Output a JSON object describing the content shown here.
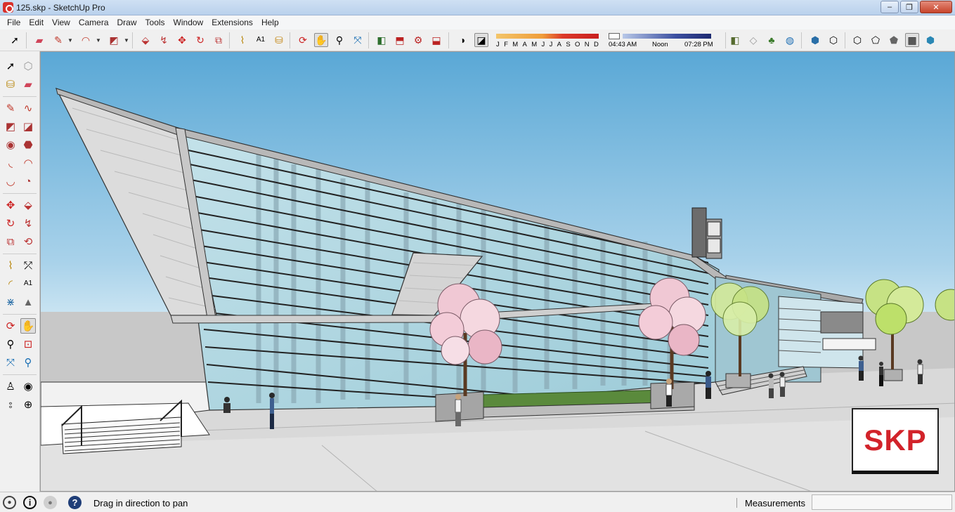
{
  "window": {
    "title": "125.skp - SketchUp Pro",
    "controls": {
      "minimize": "–",
      "maximize": "❐",
      "close": "✕"
    }
  },
  "menu": [
    "File",
    "Edit",
    "View",
    "Camera",
    "Draw",
    "Tools",
    "Window",
    "Extensions",
    "Help"
  ],
  "shadow_settings": {
    "months": [
      "J",
      "F",
      "M",
      "A",
      "M",
      "J",
      "J",
      "A",
      "S",
      "O",
      "N",
      "D"
    ],
    "sunrise": "04:43 AM",
    "noon": "Noon",
    "sunset": "07:28 PM"
  },
  "active_tool": "pan",
  "status": {
    "message": "Drag in direction to pan",
    "measurements_label": "Measurements",
    "measurements_value": ""
  },
  "watermark": {
    "text": "SKP",
    "color": "#d2232a"
  },
  "colors": {
    "sky_top": "#5aa8d6",
    "sky_bottom": "#d6ebf5",
    "glass": "#b4dbe6",
    "ground": "#d9d9d9",
    "tree_blossom": "#f0c8d4",
    "tree_green": "#bde06a"
  }
}
